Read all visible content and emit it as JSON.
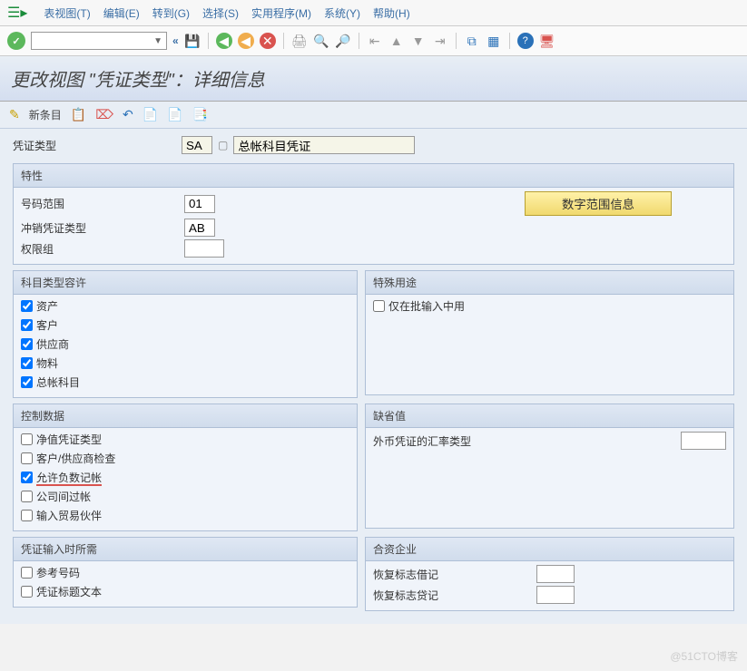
{
  "menu": {
    "table": "表视图(T)",
    "edit": "编辑(E)",
    "goto": "转到(G)",
    "select": "选择(S)",
    "util": "实用程序(M)",
    "system": "系统(Y)",
    "help": "帮助(H)"
  },
  "title": "更改视图 \"凭证类型\"：详细信息",
  "subtoolbar": {
    "new": "新条目"
  },
  "header": {
    "type_label": "凭证类型",
    "type_code": "SA",
    "type_desc": "总帐科目凭证"
  },
  "g_properties": {
    "title": "特性",
    "number_range": "号码范围",
    "number_range_val": "01",
    "rev_type": "冲销凭证类型",
    "rev_type_val": "AB",
    "auth_group": "权限组",
    "auth_group_val": "",
    "btn": "数字范围信息"
  },
  "g_accttype": {
    "title": "科目类型容许",
    "items": [
      "资产",
      "客户",
      "供应商",
      "物料",
      "总帐科目"
    ],
    "checked": [
      true,
      true,
      true,
      true,
      true
    ]
  },
  "g_special": {
    "title": "特殊用途",
    "item": "仅在批输入中用",
    "checked": false
  },
  "g_control": {
    "title": "控制数据",
    "items": [
      "净值凭证类型",
      "客户/供应商检查",
      "允许负数记帐",
      "公司间过帐",
      "输入贸易伙伴"
    ],
    "checked": [
      false,
      false,
      true,
      false,
      false
    ]
  },
  "g_defaults": {
    "title": "缺省值",
    "curr": "外币凭证的汇率类型",
    "curr_val": ""
  },
  "g_required": {
    "title": "凭证输入时所需",
    "items": [
      "参考号码",
      "凭证标题文本"
    ],
    "checked": [
      false,
      false
    ]
  },
  "g_jv": {
    "title": "合资企业",
    "debit": "恢复标志借记",
    "debit_val": "",
    "credit": "恢复标志贷记",
    "credit_val": ""
  },
  "watermark": "@51CTO博客"
}
